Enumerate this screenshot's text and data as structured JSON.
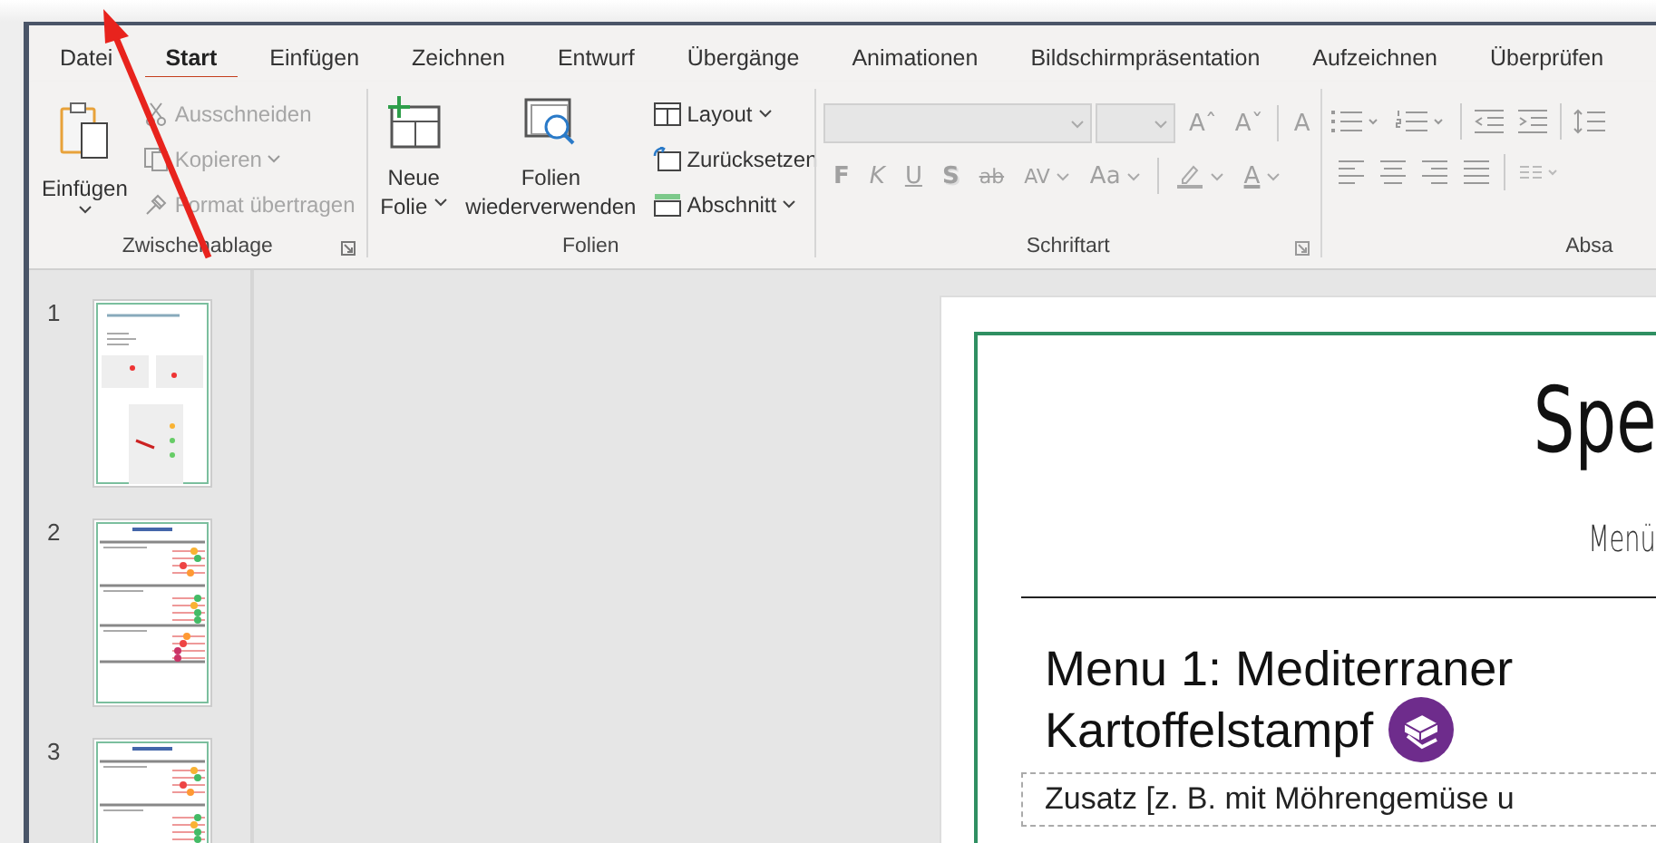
{
  "tabs": [
    {
      "label": "Datei",
      "selected": false
    },
    {
      "label": "Start",
      "selected": true
    },
    {
      "label": "Einfügen",
      "selected": false
    },
    {
      "label": "Zeichnen",
      "selected": false
    },
    {
      "label": "Entwurf",
      "selected": false
    },
    {
      "label": "Übergänge",
      "selected": false
    },
    {
      "label": "Animationen",
      "selected": false
    },
    {
      "label": "Bildschirmpräsentation",
      "selected": false
    },
    {
      "label": "Aufzeichnen",
      "selected": false
    },
    {
      "label": "Überprüfen",
      "selected": false
    }
  ],
  "clipboard": {
    "paste": "Einfügen",
    "group_label": "Zwischenablage",
    "items": [
      {
        "label": "Ausschneiden",
        "kind": "cut",
        "disabled": true,
        "dropdown": false
      },
      {
        "label": "Kopieren",
        "kind": "copy",
        "disabled": true,
        "dropdown": true
      },
      {
        "label": "Format übertragen",
        "kind": "brush",
        "disabled": true,
        "dropdown": false
      }
    ]
  },
  "slides_group": {
    "group_label": "Folien",
    "new_slide": [
      "Neue",
      "Folie"
    ],
    "reuse": [
      "Folien",
      "wiederverwenden"
    ],
    "items": [
      {
        "label": "Layout",
        "kind": "layout",
        "dropdown": true
      },
      {
        "label": "Zurücksetzen",
        "kind": "reset",
        "dropdown": false
      },
      {
        "label": "Abschnitt",
        "kind": "section",
        "dropdown": true
      }
    ]
  },
  "font_group": {
    "group_label": "Schriftart",
    "disabled": true,
    "row_1": [
      {
        "label": "Aˆ",
        "kind": "grow"
      },
      {
        "label": "Aˇ",
        "kind": "shrink"
      },
      {
        "label": "A",
        "kind": "clear"
      }
    ],
    "row_2": [
      {
        "label": "F",
        "kind": "bold",
        "dropdown": false
      },
      {
        "label": "K",
        "kind": "italic",
        "dropdown": false
      },
      {
        "label": "U",
        "kind": "underline",
        "dropdown": false
      },
      {
        "label": "S",
        "kind": "shadow",
        "dropdown": false
      },
      {
        "label": "ab",
        "kind": "strike",
        "dropdown": false
      },
      {
        "label": "AV",
        "kind": "spacing",
        "dropdown": true
      },
      {
        "label": "Aa",
        "kind": "case",
        "dropdown": true
      },
      {
        "kind": "highlight",
        "dropdown": true
      },
      {
        "label": "A",
        "kind": "color",
        "dropdown": true
      }
    ]
  },
  "paragraph_group": {
    "group_label": "Absa"
  },
  "thumbnails": [
    {
      "number": "1",
      "kind": "instructions"
    },
    {
      "number": "2",
      "kind": "ratings"
    },
    {
      "number": "3",
      "kind": "ratings"
    }
  ],
  "slide": {
    "title": "Spe",
    "subtitle": "Menü",
    "heading_1": "Menu 1: Mediterraner",
    "heading_2": "Kartoffelstampf",
    "note": "Zusatz [z. B. mit Möhrengemüse u"
  }
}
